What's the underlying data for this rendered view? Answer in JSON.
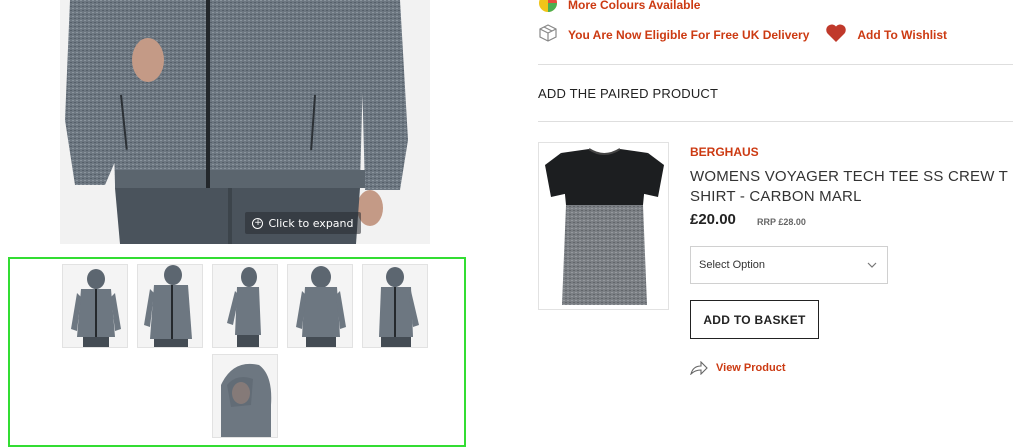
{
  "main_image": {
    "expand_label": "Click to expand",
    "jacket_color": "#5c6670"
  },
  "gallery": {
    "thumbnails": [
      {
        "name": "front-view"
      },
      {
        "name": "front-detail-view"
      },
      {
        "name": "side-view"
      },
      {
        "name": "back-view"
      },
      {
        "name": "side-back-view"
      },
      {
        "name": "hood-detail-view"
      }
    ]
  },
  "info": {
    "more_colours_label": "More Colours Available",
    "delivery_label": "You Are Now Eligible For Free UK Delivery",
    "wishlist_label": "Add To Wishlist"
  },
  "paired_product": {
    "section_title": "ADD THE PAIRED PRODUCT",
    "brand": "BERGHAUS",
    "name": "WOMENS VOYAGER TECH TEE SS CREW T SHIRT - CARBON MARL",
    "price": "£20.00",
    "rrp": "RRP £28.00",
    "select_placeholder": "Select Option",
    "add_to_basket_label": "ADD TO BASKET",
    "view_product_label": "View Product"
  },
  "colors": {
    "accent": "#cc3a12",
    "wishlist_heart": "#c0392b",
    "gallery_border": "#33dd33"
  }
}
